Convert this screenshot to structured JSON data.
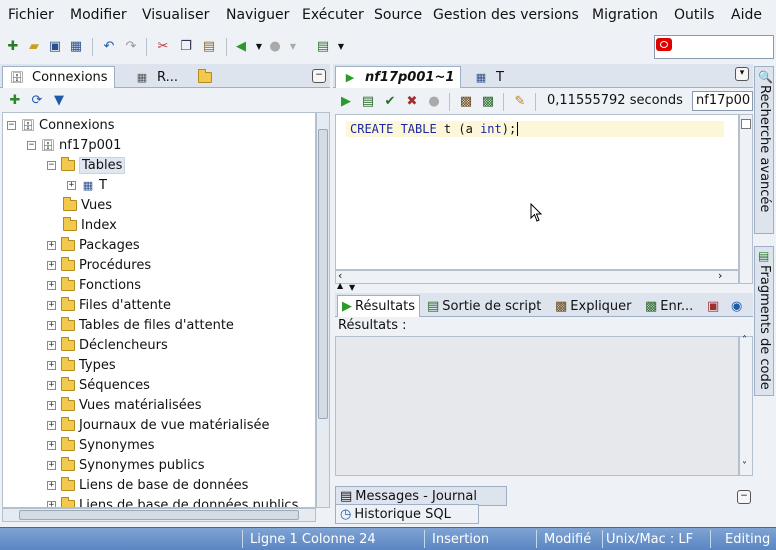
{
  "menu": [
    "Fichier",
    "Modifier",
    "Visualiser",
    "Naviguer",
    "Exécuter",
    "Source",
    "Gestion des versions",
    "Migration",
    "Outils",
    "Aide"
  ],
  "left_panel": {
    "tabs": [
      "Connexions",
      "R...",
      ""
    ],
    "tree": {
      "root": "Connexions",
      "connection": "nf17p001",
      "tables": "Tables",
      "table_t": "T",
      "items": [
        "Vues",
        "Index",
        "Packages",
        "Procédures",
        "Fonctions",
        "Files d'attente",
        "Tables de files d'attente",
        "Déclencheurs",
        "Types",
        "Séquences",
        "Vues matérialisées",
        "Journaux de vue matérialisée",
        "Synonymes",
        "Synonymes publics",
        "Liens de base de données",
        "Liens de base de données publics"
      ]
    }
  },
  "editor": {
    "tabs": [
      "nf17p001~1",
      "T"
    ],
    "elapsed": "0,11555792 seconds",
    "connection_select": "nf17p00",
    "sql_keyword1": "CREATE TABLE",
    "sql_rest1": " t (a ",
    "sql_keyword2": "int",
    "sql_rest2": ");"
  },
  "results": {
    "tabs": [
      "Résultats",
      "Sortie de script",
      "Expliquer",
      "Enr..."
    ],
    "label": "Résultats :"
  },
  "bottom_tabs": [
    "Messages - Journal",
    "Historique SQL"
  ],
  "side_tabs": [
    "Recherche avancée",
    "Fragments de code"
  ],
  "status": {
    "position": "Ligne 1 Colonne 24",
    "mode": "Insertion",
    "modified": "Modifié",
    "eol": "Unix/Mac : LF",
    "state": "Editing"
  },
  "colors": {
    "status_bar": "#5b86c3",
    "sql_keyword": "#1a28a8",
    "current_line": "#fbf7d8"
  }
}
